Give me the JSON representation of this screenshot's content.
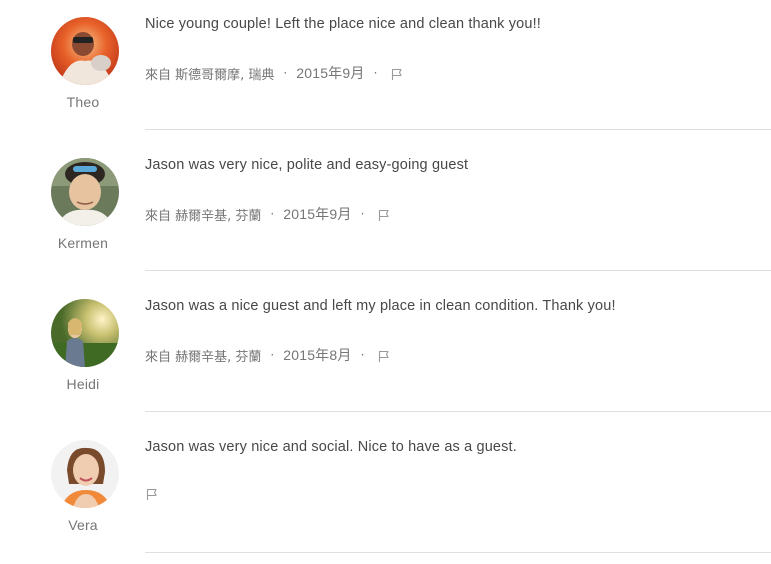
{
  "reviews": [
    {
      "reviewer": "Theo",
      "text": "Nice young couple! Left the place nice and clean thank you!!",
      "from": "來自 斯德哥爾摩, 瑞典",
      "date": "2015年9月",
      "avatar_icon": "reviewer-photo",
      "dot": "·"
    },
    {
      "reviewer": "Kermen",
      "text": "Jason was very nice, polite and easy-going guest",
      "from": "來自 赫爾辛基, 芬蘭",
      "date": "2015年9月",
      "avatar_icon": "reviewer-photo",
      "dot": "·"
    },
    {
      "reviewer": "Heidi",
      "text": "Jason was a nice guest and left my place in clean condition. Thank you!",
      "from": "來自 赫爾辛基, 芬蘭",
      "date": "2015年8月",
      "avatar_icon": "reviewer-photo",
      "dot": "·"
    },
    {
      "reviewer": "Vera",
      "text": "Jason was very nice and social. Nice to have as a guest.",
      "from": "",
      "date": "",
      "avatar_icon": "reviewer-photo",
      "dot": ""
    }
  ],
  "colors": {
    "text": "#484848",
    "muted": "#767676",
    "divider": "#dce0e0"
  },
  "icons": {
    "flag": "flag-icon"
  }
}
